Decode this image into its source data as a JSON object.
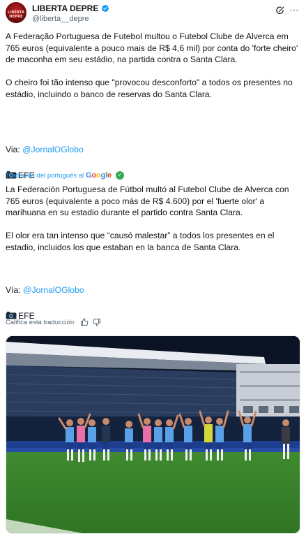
{
  "author": {
    "display_name": "LIBERTA DEPRE",
    "handle": "@liberta__depre",
    "avatar_text": "LIBERTA DEPRE"
  },
  "tweet": {
    "original_text": "A Federação Portuguesa de Futebol multou o Futebol Clube de Alverca em 765 euros (equivalente a pouco mais de R$ 4,6 mil) por conta do 'forte cheiro' de maconha em seu estádio, na partida contra o Santa Clara.\n\nO cheiro foi tão intenso que \"provocou desconforto\" a todos os presentes no estádio, incluindo o banco de reservas do Santa Clara.",
    "original_via_prefix": "Via: ",
    "original_via_link": "@JornalOGlobo",
    "original_credit": "EFE"
  },
  "translation": {
    "label": "Traducido del portugués al",
    "provider": "Google",
    "text": "La Federación Portuguesa de Fútbol multó al Futebol Clube de Alverca con 765 euros (equivalente a poco más de R$ 4.600) por el 'fuerte olor' a marihuana en su estadio durante el partido contra Santa Clara.\n\nEl olor era tan intenso que “causó malestar” a todos los presentes en el estadio, incluidos los que estaban en la banca de Santa Clara.",
    "via_prefix": "Vía: ",
    "via_link": "@JornalOGlobo",
    "credit": "EFE",
    "rate_label": "Califica esta traducción:"
  },
  "icons": {
    "verified": "verified-badge-icon",
    "grok": "grok-icon",
    "more": "more-options-icon",
    "camera": "camera-icon",
    "thumbs_up": "thumbs-up-icon",
    "thumbs_down": "thumbs-down-icon",
    "check": "check-icon"
  },
  "colors": {
    "link": "#1d9bf0",
    "text": "#0f1419",
    "secondary": "#536471",
    "pitch": "#3f8a2f"
  }
}
